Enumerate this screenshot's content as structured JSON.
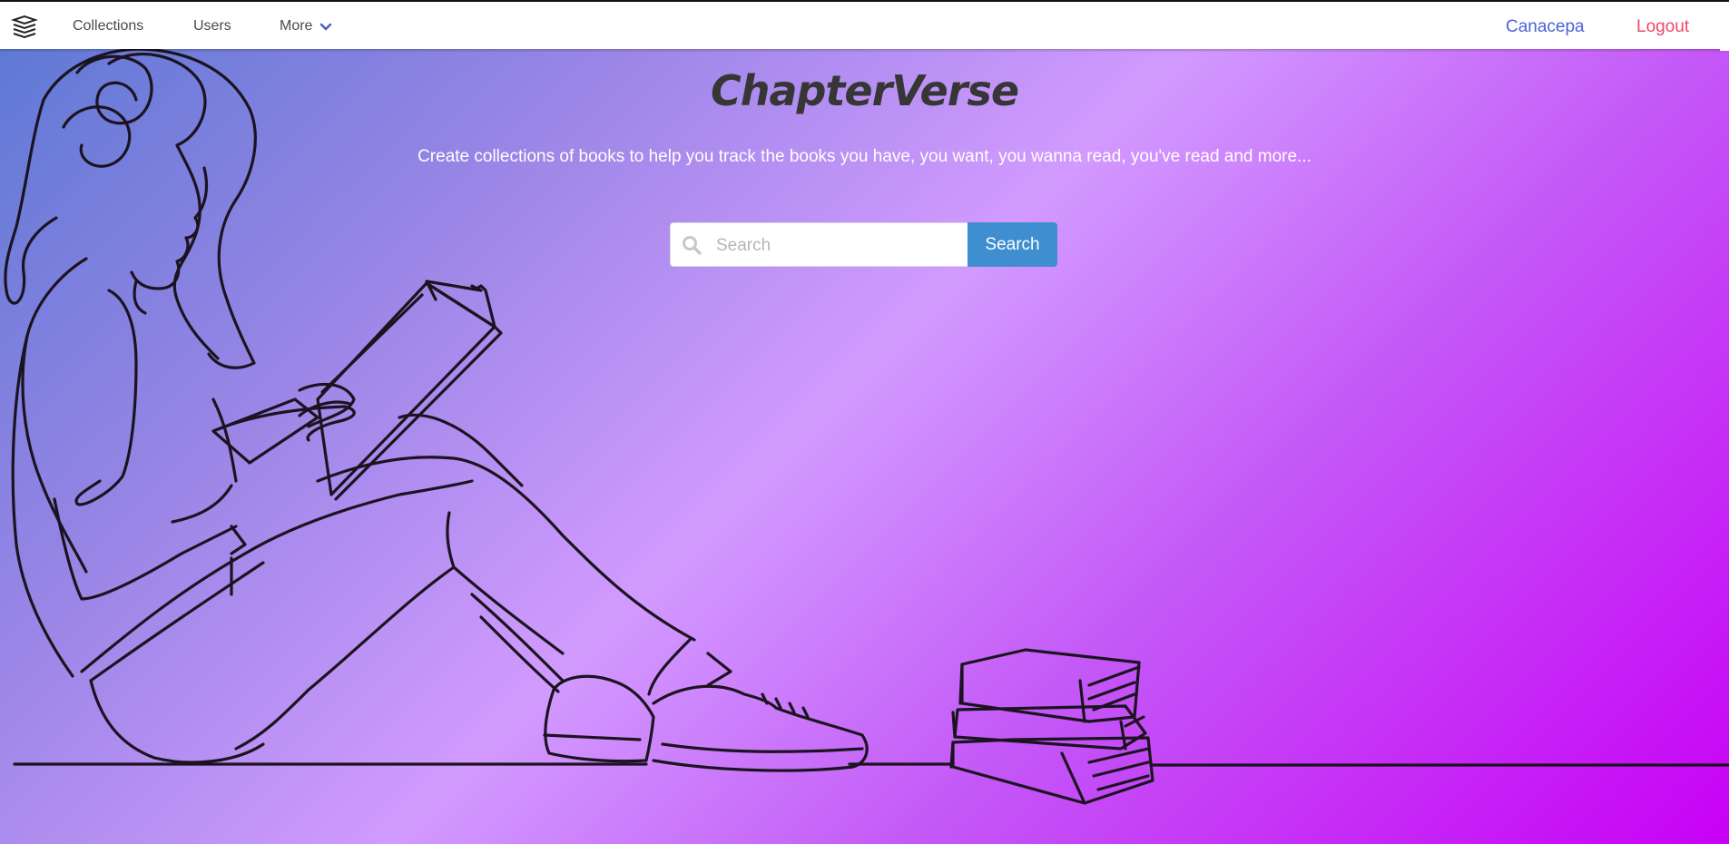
{
  "nav": {
    "logo_icon": "book-stack-icon",
    "items": [
      {
        "label": "Collections"
      },
      {
        "label": "Users"
      }
    ],
    "more_label": "More",
    "more_icon": "chevron-down-icon",
    "user_label": "Canacepa",
    "logout_label": "Logout"
  },
  "hero": {
    "title": "ChapterVerse",
    "subtitle": "Create collections of books to help you track the books you have, you want, you wanna read, you've read and more..."
  },
  "search": {
    "placeholder": "Search",
    "value": "",
    "button_label": "Search",
    "icon": "magnifier-icon"
  },
  "colors": {
    "gradient_start": "#5a78d4",
    "gradient_mid": "#d29aff",
    "gradient_end": "#c800f5",
    "accent_blue": "#3e8ed0",
    "user_link": "#4a62d8",
    "logout_link": "#f0476a"
  },
  "illustration": "reading-woman-line-art"
}
